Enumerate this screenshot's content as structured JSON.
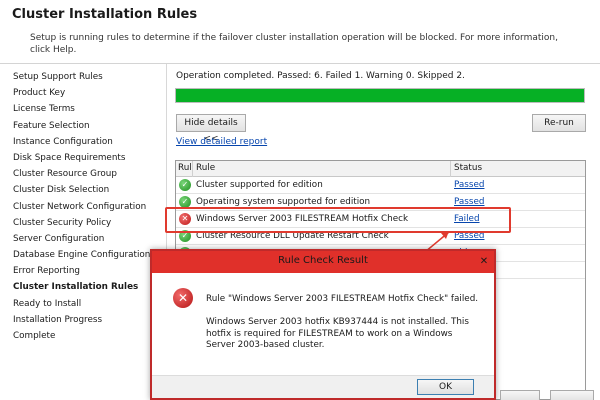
{
  "header": {
    "title": "Cluster Installation Rules",
    "description": "Setup is running rules to determine if the failover cluster installation operation will be blocked. For more information, click Help."
  },
  "sidebar": {
    "items": [
      "Setup Support Rules",
      "Product Key",
      "License Terms",
      "Feature Selection",
      "Instance Configuration",
      "Disk Space Requirements",
      "Cluster Resource Group",
      "Cluster Disk Selection",
      "Cluster Network Configuration",
      "Cluster Security Policy",
      "Server Configuration",
      "Database Engine Configuration",
      "Error Reporting",
      "Cluster Installation Rules",
      "Ready to Install",
      "Installation Progress",
      "Complete"
    ],
    "active_index": 13
  },
  "main": {
    "status_line": "Operation completed. Passed: 6.   Failed 1.   Warning 0.   Skipped 2.",
    "progress": 1.0,
    "hide_details_label": "Hide details <<",
    "rerun_label": "Re-run",
    "view_report_label": "View detailed report",
    "grid": {
      "headers": [
        "Rul",
        "Rule",
        "Status"
      ],
      "rows": [
        {
          "rule": "Cluster supported for edition",
          "status": "Passed",
          "result": "ok"
        },
        {
          "rule": "Operating system supported for edition",
          "status": "Passed",
          "result": "ok"
        },
        {
          "rule": "Windows Server 2003 FILESTREAM Hotfix Check",
          "status": "Failed",
          "result": "fail"
        },
        {
          "rule": "Cluster Resource DLL Update Restart Check",
          "status": "Passed",
          "result": "ok"
        },
        {
          "rule": "",
          "status": "able",
          "result": "ok"
        },
        {
          "rule": "",
          "status": "able",
          "result": "ok"
        }
      ]
    }
  },
  "dialog": {
    "title": "Rule Check Result",
    "close_label": "✕",
    "message_title": "Rule \"Windows Server 2003 FILESTREAM Hotfix Check\" failed.",
    "message_body": "Windows Server 2003 hotfix KB937444 is not installed. This hotfix is required for FILESTREAM to work on a Windows Server 2003-based cluster.",
    "ok_label": "OK"
  },
  "colors": {
    "progress_fill": "#06b025",
    "highlight": "#e03a2e",
    "dialog_title": "#e0302a",
    "link": "#0645ad"
  },
  "icons": {
    "passed": "check-circle-icon",
    "failed": "error-circle-icon",
    "dialog_error": "error-circle-icon"
  }
}
